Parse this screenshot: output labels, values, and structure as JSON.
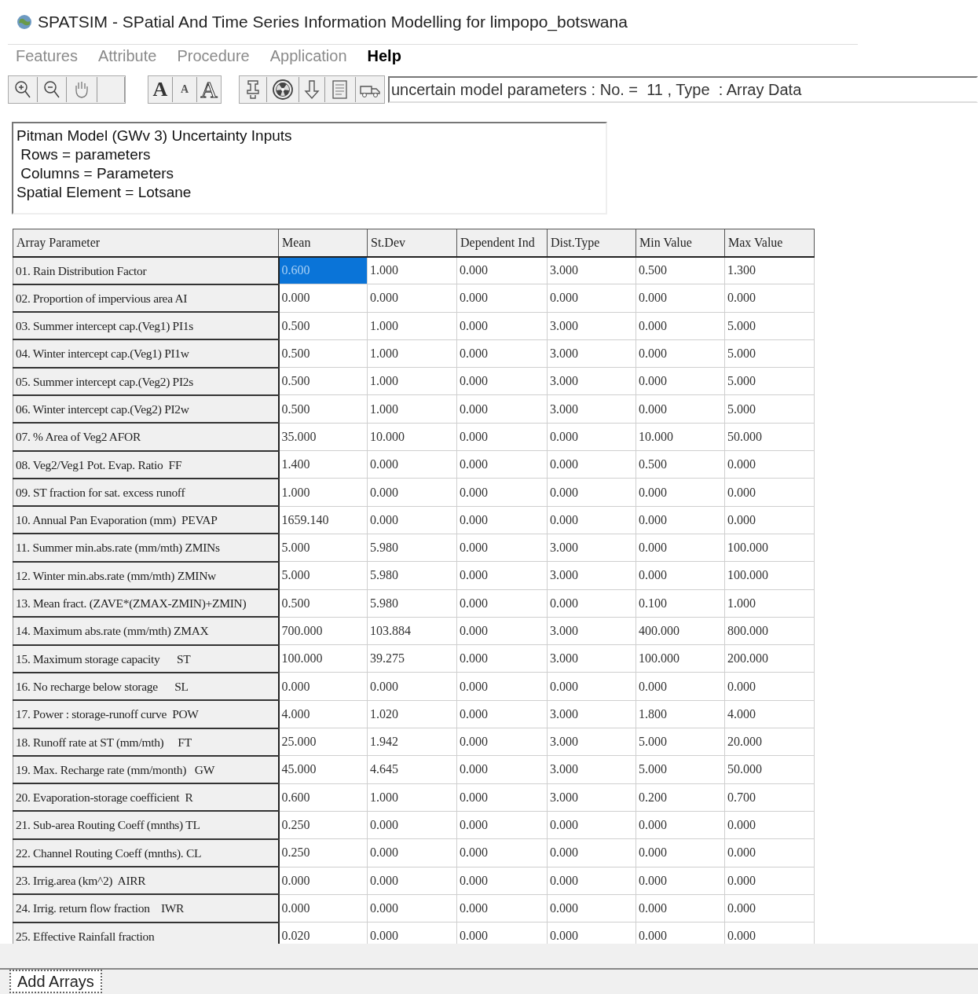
{
  "window": {
    "title": "SPATSIM - SPatial And Time Series Information Modelling for limpopo_botswana"
  },
  "menu": [
    {
      "label": "Features",
      "disabled": true
    },
    {
      "label": "Attribute",
      "disabled": true
    },
    {
      "label": "Procedure",
      "disabled": true
    },
    {
      "label": "Application",
      "disabled": true
    },
    {
      "label": "Help",
      "disabled": false
    }
  ],
  "toolbar": {
    "font_buttons": [
      {
        "label": "A",
        "kind": "large"
      },
      {
        "label": "A",
        "kind": "small"
      },
      {
        "label": "A",
        "kind": "outline"
      }
    ],
    "status_field": "uncertain model parameters : No. =  11 , Type  : Array Data"
  },
  "info_box": {
    "lines": [
      "Pitman Model (GWv 3) Uncertainty Inputs",
      " Rows = parameters",
      " Columns = Parameters",
      "Spatial Element = Lotsane"
    ]
  },
  "table": {
    "columns": [
      "Array Parameter",
      "Mean",
      "St.Dev",
      "Dependent Ind",
      "Dist.Type",
      "Min Value",
      "Max Value"
    ],
    "rows": [
      {
        "cells": [
          {
            "text": "01. Rain Distribution Factor",
            "selected": false
          },
          {
            "text": "0.600",
            "selected": true
          },
          {
            "text": "1.000",
            "selected": false
          },
          {
            "text": "0.000",
            "selected": false
          },
          {
            "text": "3.000",
            "selected": false
          },
          {
            "text": "0.500",
            "selected": false
          },
          {
            "text": "1.300",
            "selected": false
          }
        ]
      },
      {
        "cells": [
          {
            "text": "02. Proportion of impervious area AI",
            "selected": false
          },
          {
            "text": "0.000",
            "selected": false
          },
          {
            "text": "0.000",
            "selected": false
          },
          {
            "text": "0.000",
            "selected": false
          },
          {
            "text": "0.000",
            "selected": false
          },
          {
            "text": "0.000",
            "selected": false
          },
          {
            "text": "0.000",
            "selected": false
          }
        ]
      },
      {
        "cells": [
          {
            "text": "03. Summer intercept cap.(Veg1) PI1s",
            "selected": false
          },
          {
            "text": "0.500",
            "selected": false
          },
          {
            "text": "1.000",
            "selected": false
          },
          {
            "text": "0.000",
            "selected": false
          },
          {
            "text": "3.000",
            "selected": false
          },
          {
            "text": "0.000",
            "selected": false
          },
          {
            "text": "5.000",
            "selected": false
          }
        ]
      },
      {
        "cells": [
          {
            "text": "04. Winter intercept cap.(Veg1) PI1w",
            "selected": false
          },
          {
            "text": "0.500",
            "selected": false
          },
          {
            "text": "1.000",
            "selected": false
          },
          {
            "text": "0.000",
            "selected": false
          },
          {
            "text": "3.000",
            "selected": false
          },
          {
            "text": "0.000",
            "selected": false
          },
          {
            "text": "5.000",
            "selected": false
          }
        ]
      },
      {
        "cells": [
          {
            "text": "05. Summer intercept cap.(Veg2) PI2s",
            "selected": false
          },
          {
            "text": "0.500",
            "selected": false
          },
          {
            "text": "1.000",
            "selected": false
          },
          {
            "text": "0.000",
            "selected": false
          },
          {
            "text": "3.000",
            "selected": false
          },
          {
            "text": "0.000",
            "selected": false
          },
          {
            "text": "5.000",
            "selected": false
          }
        ]
      },
      {
        "cells": [
          {
            "text": "06. Winter intercept cap.(Veg2) PI2w",
            "selected": false
          },
          {
            "text": "0.500",
            "selected": false
          },
          {
            "text": "1.000",
            "selected": false
          },
          {
            "text": "0.000",
            "selected": false
          },
          {
            "text": "3.000",
            "selected": false
          },
          {
            "text": "0.000",
            "selected": false
          },
          {
            "text": "5.000",
            "selected": false
          }
        ]
      },
      {
        "cells": [
          {
            "text": "07. % Area of Veg2 AFOR",
            "selected": false
          },
          {
            "text": "35.000",
            "selected": false
          },
          {
            "text": "10.000",
            "selected": false
          },
          {
            "text": "0.000",
            "selected": false
          },
          {
            "text": "0.000",
            "selected": false
          },
          {
            "text": "10.000",
            "selected": false
          },
          {
            "text": "50.000",
            "selected": false
          }
        ]
      },
      {
        "cells": [
          {
            "text": "08. Veg2/Veg1 Pot. Evap. Ratio  FF",
            "selected": false
          },
          {
            "text": "1.400",
            "selected": false
          },
          {
            "text": "0.000",
            "selected": false
          },
          {
            "text": "0.000",
            "selected": false
          },
          {
            "text": "0.000",
            "selected": false
          },
          {
            "text": "0.500",
            "selected": false
          },
          {
            "text": "0.000",
            "selected": false
          }
        ]
      },
      {
        "cells": [
          {
            "text": "09. ST fraction for sat. excess runoff",
            "selected": false
          },
          {
            "text": "1.000",
            "selected": false
          },
          {
            "text": "0.000",
            "selected": false
          },
          {
            "text": "0.000",
            "selected": false
          },
          {
            "text": "0.000",
            "selected": false
          },
          {
            "text": "0.000",
            "selected": false
          },
          {
            "text": "0.000",
            "selected": false
          }
        ]
      },
      {
        "cells": [
          {
            "text": "10. Annual Pan Evaporation (mm)  PEVAP",
            "selected": false
          },
          {
            "text": "1659.140",
            "selected": false
          },
          {
            "text": "0.000",
            "selected": false
          },
          {
            "text": "0.000",
            "selected": false
          },
          {
            "text": "0.000",
            "selected": false
          },
          {
            "text": "0.000",
            "selected": false
          },
          {
            "text": "0.000",
            "selected": false
          }
        ]
      },
      {
        "cells": [
          {
            "text": "11. Summer min.abs.rate (mm/mth) ZMINs",
            "selected": false
          },
          {
            "text": "5.000",
            "selected": false
          },
          {
            "text": "5.980",
            "selected": false
          },
          {
            "text": "0.000",
            "selected": false
          },
          {
            "text": "3.000",
            "selected": false
          },
          {
            "text": "0.000",
            "selected": false
          },
          {
            "text": "100.000",
            "selected": false
          }
        ]
      },
      {
        "cells": [
          {
            "text": "12. Winter min.abs.rate (mm/mth) ZMINw",
            "selected": false
          },
          {
            "text": "5.000",
            "selected": false
          },
          {
            "text": "5.980",
            "selected": false
          },
          {
            "text": "0.000",
            "selected": false
          },
          {
            "text": "3.000",
            "selected": false
          },
          {
            "text": "0.000",
            "selected": false
          },
          {
            "text": "100.000",
            "selected": false
          }
        ]
      },
      {
        "cells": [
          {
            "text": "13. Mean fract. (ZAVE*(ZMAX-ZMIN)+ZMIN)",
            "selected": false
          },
          {
            "text": "0.500",
            "selected": false
          },
          {
            "text": "5.980",
            "selected": false
          },
          {
            "text": "0.000",
            "selected": false
          },
          {
            "text": "0.000",
            "selected": false
          },
          {
            "text": "0.100",
            "selected": false
          },
          {
            "text": "1.000",
            "selected": false
          }
        ]
      },
      {
        "cells": [
          {
            "text": "14. Maximum abs.rate (mm/mth) ZMAX",
            "selected": false
          },
          {
            "text": "700.000",
            "selected": false
          },
          {
            "text": "103.884",
            "selected": false
          },
          {
            "text": "0.000",
            "selected": false
          },
          {
            "text": "3.000",
            "selected": false
          },
          {
            "text": "400.000",
            "selected": false
          },
          {
            "text": "800.000",
            "selected": false
          }
        ]
      },
      {
        "cells": [
          {
            "text": "15. Maximum storage capacity      ST",
            "selected": false
          },
          {
            "text": "100.000",
            "selected": false
          },
          {
            "text": "39.275",
            "selected": false
          },
          {
            "text": "0.000",
            "selected": false
          },
          {
            "text": "3.000",
            "selected": false
          },
          {
            "text": "100.000",
            "selected": false
          },
          {
            "text": "200.000",
            "selected": false
          }
        ]
      },
      {
        "cells": [
          {
            "text": "16. No recharge below storage      SL",
            "selected": false
          },
          {
            "text": "0.000",
            "selected": false
          },
          {
            "text": "0.000",
            "selected": false
          },
          {
            "text": "0.000",
            "selected": false
          },
          {
            "text": "0.000",
            "selected": false
          },
          {
            "text": "0.000",
            "selected": false
          },
          {
            "text": "0.000",
            "selected": false
          }
        ]
      },
      {
        "cells": [
          {
            "text": "17. Power : storage-runoff curve  POW",
            "selected": false
          },
          {
            "text": "4.000",
            "selected": false
          },
          {
            "text": "1.020",
            "selected": false
          },
          {
            "text": "0.000",
            "selected": false
          },
          {
            "text": "3.000",
            "selected": false
          },
          {
            "text": "1.800",
            "selected": false
          },
          {
            "text": "4.000",
            "selected": false
          }
        ]
      },
      {
        "cells": [
          {
            "text": "18. Runoff rate at ST (mm/mth)     FT",
            "selected": false
          },
          {
            "text": "25.000",
            "selected": false
          },
          {
            "text": "1.942",
            "selected": false
          },
          {
            "text": "0.000",
            "selected": false
          },
          {
            "text": "3.000",
            "selected": false
          },
          {
            "text": "5.000",
            "selected": false
          },
          {
            "text": "20.000",
            "selected": false
          }
        ]
      },
      {
        "cells": [
          {
            "text": "19. Max. Recharge rate (mm/month)   GW",
            "selected": false
          },
          {
            "text": "45.000",
            "selected": false
          },
          {
            "text": "4.645",
            "selected": false
          },
          {
            "text": "0.000",
            "selected": false
          },
          {
            "text": "3.000",
            "selected": false
          },
          {
            "text": "5.000",
            "selected": false
          },
          {
            "text": "50.000",
            "selected": false
          }
        ]
      },
      {
        "cells": [
          {
            "text": "20. Evaporation-storage coefficient  R",
            "selected": false
          },
          {
            "text": "0.600",
            "selected": false
          },
          {
            "text": "1.000",
            "selected": false
          },
          {
            "text": "0.000",
            "selected": false
          },
          {
            "text": "3.000",
            "selected": false
          },
          {
            "text": "0.200",
            "selected": false
          },
          {
            "text": "0.700",
            "selected": false
          }
        ]
      },
      {
        "cells": [
          {
            "text": "21. Sub-area Routing Coeff (mnths) TL",
            "selected": false
          },
          {
            "text": "0.250",
            "selected": false
          },
          {
            "text": "0.000",
            "selected": false
          },
          {
            "text": "0.000",
            "selected": false
          },
          {
            "text": "0.000",
            "selected": false
          },
          {
            "text": "0.000",
            "selected": false
          },
          {
            "text": "0.000",
            "selected": false
          }
        ]
      },
      {
        "cells": [
          {
            "text": "22. Channel Routing Coeff (mnths). CL",
            "selected": false
          },
          {
            "text": "0.250",
            "selected": false
          },
          {
            "text": "0.000",
            "selected": false
          },
          {
            "text": "0.000",
            "selected": false
          },
          {
            "text": "0.000",
            "selected": false
          },
          {
            "text": "0.000",
            "selected": false
          },
          {
            "text": "0.000",
            "selected": false
          }
        ]
      },
      {
        "cells": [
          {
            "text": "23. Irrig.area (km^2)  AIRR",
            "selected": false
          },
          {
            "text": "0.000",
            "selected": false
          },
          {
            "text": "0.000",
            "selected": false
          },
          {
            "text": "0.000",
            "selected": false
          },
          {
            "text": "0.000",
            "selected": false
          },
          {
            "text": "0.000",
            "selected": false
          },
          {
            "text": "0.000",
            "selected": false
          }
        ]
      },
      {
        "cells": [
          {
            "text": "24. Irrig. return flow fraction    IWR",
            "selected": false
          },
          {
            "text": "0.000",
            "selected": false
          },
          {
            "text": "0.000",
            "selected": false
          },
          {
            "text": "0.000",
            "selected": false
          },
          {
            "text": "0.000",
            "selected": false
          },
          {
            "text": "0.000",
            "selected": false
          },
          {
            "text": "0.000",
            "selected": false
          }
        ]
      },
      {
        "cells": [
          {
            "text": "25. Effective Rainfall fraction",
            "selected": false
          },
          {
            "text": "0.020",
            "selected": false
          },
          {
            "text": "0.000",
            "selected": false
          },
          {
            "text": "0.000",
            "selected": false
          },
          {
            "text": "0.000",
            "selected": false
          },
          {
            "text": "0.000",
            "selected": false
          },
          {
            "text": "0.000",
            "selected": false
          }
        ]
      }
    ]
  },
  "tabs": [
    {
      "label": "Add Arrays",
      "selected": true
    }
  ]
}
